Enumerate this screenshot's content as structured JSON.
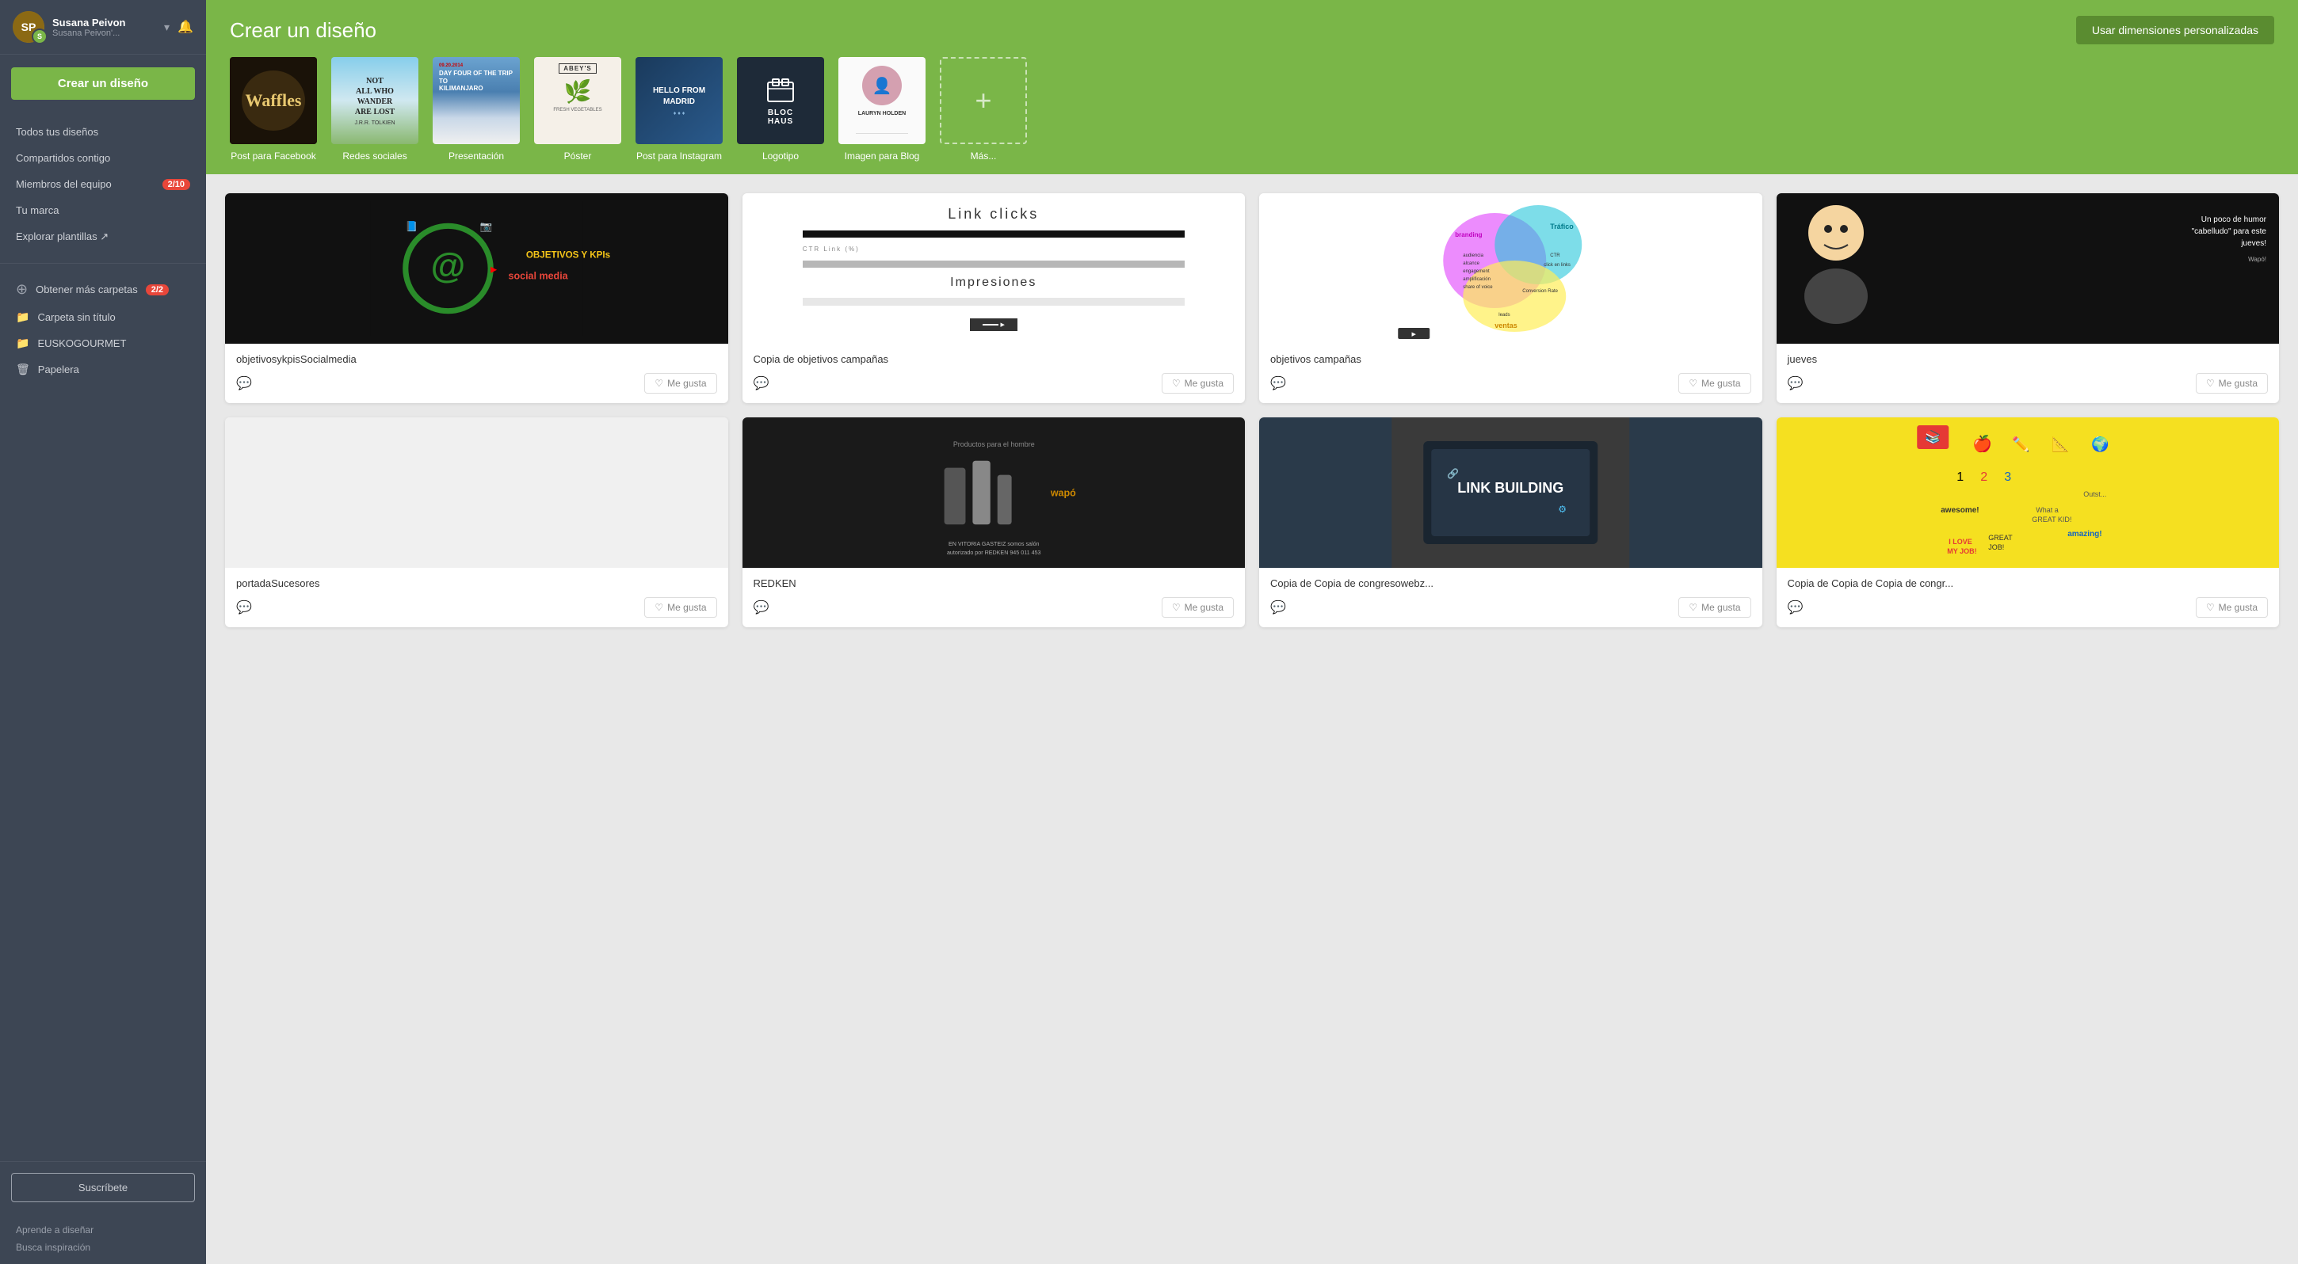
{
  "sidebar": {
    "user": {
      "name": "Susana Peivon",
      "sub": "Susana Peivon'...",
      "initials": "S"
    },
    "create_btn": "Crear un diseño",
    "nav": [
      {
        "label": "Todos tus diseños",
        "id": "all-designs"
      },
      {
        "label": "Compartidos contigo",
        "id": "shared"
      },
      {
        "label": "Miembros del equipo",
        "id": "team",
        "badge": "2/10"
      },
      {
        "label": "Tu marca",
        "id": "brand"
      },
      {
        "label": "Explorar plantillas ↗",
        "id": "templates"
      }
    ],
    "folders": {
      "add_label": "Obtener más carpetas",
      "add_badge": "2/2",
      "items": [
        {
          "label": "Carpeta sin título",
          "icon": "folder"
        },
        {
          "label": "EUSKOGOURMET",
          "icon": "folder"
        },
        {
          "label": "Papelera",
          "icon": "trash"
        }
      ]
    },
    "subscribe_btn": "Suscríbete",
    "links": [
      "Aprende a diseñar",
      "Busca inspiración"
    ]
  },
  "header": {
    "title": "Crear un diseño",
    "custom_size_btn": "Usar dimensiones personalizadas",
    "design_types": [
      {
        "label": "Post para Facebook",
        "id": "facebook"
      },
      {
        "label": "Redes sociales",
        "id": "redes"
      },
      {
        "label": "Presentación",
        "id": "presentacion"
      },
      {
        "label": "Póster",
        "id": "poster"
      },
      {
        "label": "Post para Instagram",
        "id": "instagram"
      },
      {
        "label": "Logotipo",
        "id": "logotipo"
      },
      {
        "label": "Imagen para Blog",
        "id": "blog"
      },
      {
        "label": "Más...",
        "id": "mas"
      }
    ]
  },
  "designs": [
    {
      "id": "objetivos",
      "title": "objetivosykpisSocialmedia",
      "type": "dark-social"
    },
    {
      "id": "link-clicks",
      "title": "Copia de objetivos campañas",
      "type": "link-clicks"
    },
    {
      "id": "objetivos-campanas",
      "title": "objetivos campañas",
      "type": "venn"
    },
    {
      "id": "jueves",
      "title": "jueves",
      "type": "jueves"
    },
    {
      "id": "portada",
      "title": "portadaSucesores",
      "type": "blank"
    },
    {
      "id": "redken",
      "title": "REDKEN",
      "type": "redken"
    },
    {
      "id": "link-building",
      "title": "Copia de Copia de congresowebz...",
      "type": "link-building"
    },
    {
      "id": "congreso",
      "title": "Copia de Copia de Copia de congr...",
      "type": "congreso"
    }
  ],
  "like_btn": "Me gusta",
  "colors": {
    "sidebar_bg": "#3d4654",
    "green_accent": "#7ab648",
    "badge_red": "#e8463a"
  }
}
